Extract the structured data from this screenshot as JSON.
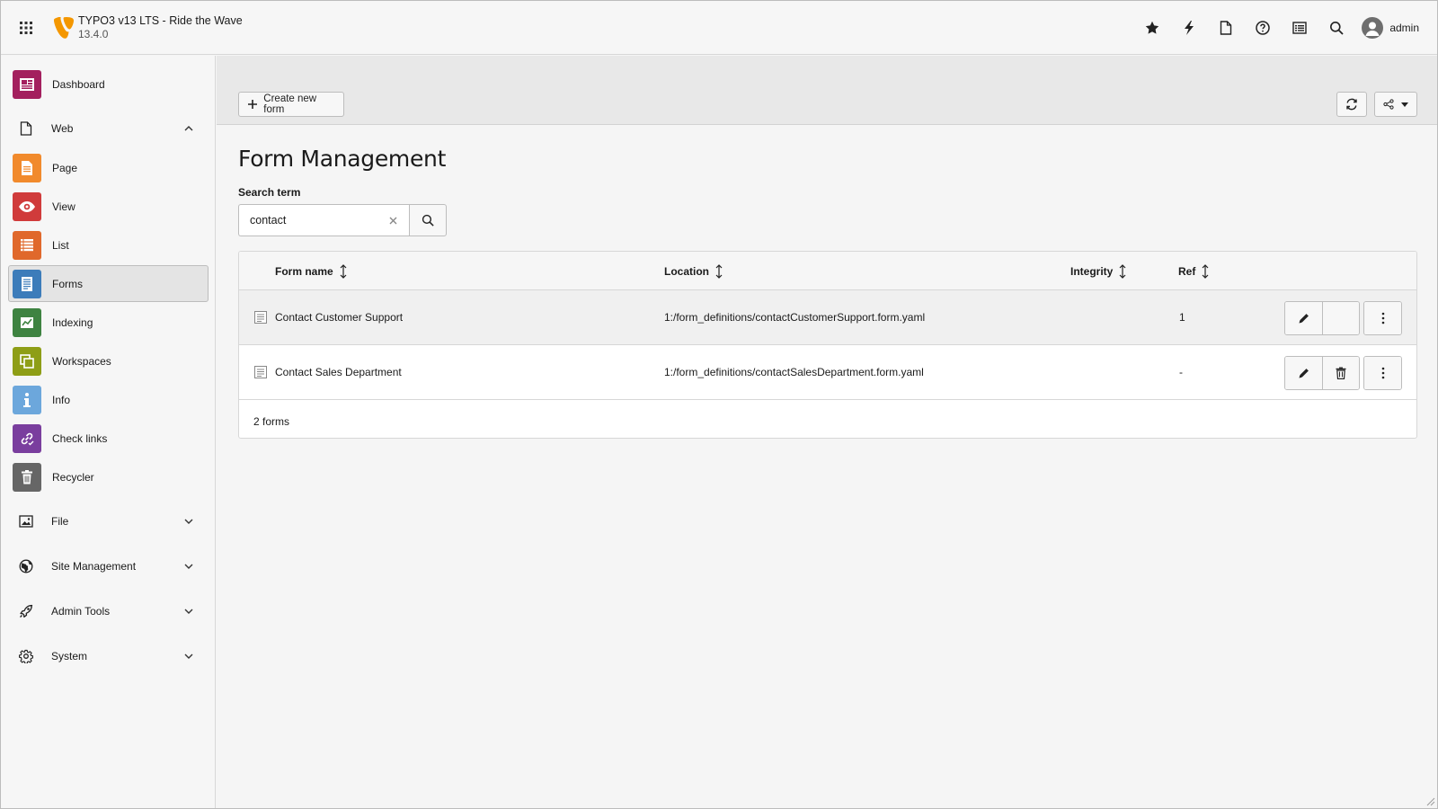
{
  "topbar": {
    "title": "TYPO3 v13 LTS - Ride the Wave",
    "version": "13.4.0",
    "user": "admin",
    "brand_color": "#f49700"
  },
  "sidebar": {
    "dashboard": "Dashboard",
    "web": "Web",
    "items": [
      {
        "label": "Page",
        "color": "#f18a2c"
      },
      {
        "label": "View",
        "color": "#d03b3b"
      },
      {
        "label": "List",
        "color": "#e0682b"
      },
      {
        "label": "Forms",
        "color": "#3c7cba"
      },
      {
        "label": "Indexing",
        "color": "#3e8341"
      },
      {
        "label": "Workspaces",
        "color": "#8e9e16"
      },
      {
        "label": "Info",
        "color": "#6ca7dc"
      },
      {
        "label": "Check links",
        "color": "#7a3e9e"
      },
      {
        "label": "Recycler",
        "color": "#666666"
      }
    ],
    "groups": {
      "file": "File",
      "site_management": "Site Management",
      "admin_tools": "Admin Tools",
      "system": "System"
    },
    "dashboard_color": "#a3205e"
  },
  "docheader": {
    "create_label": "Create new form"
  },
  "main": {
    "title": "Form Management",
    "search_label": "Search term",
    "search_value": "contact"
  },
  "table": {
    "headers": {
      "name": "Form name",
      "location": "Location",
      "integrity": "Integrity",
      "ref": "Ref"
    },
    "rows": [
      {
        "name": "Contact Customer Support",
        "location": "1:/form_definitions/contactCustomerSupport.form.yaml",
        "ref": "1"
      },
      {
        "name": "Contact Sales Department",
        "location": "1:/form_definitions/contactSalesDepartment.form.yaml",
        "ref": "-"
      }
    ],
    "footer": "2 forms"
  }
}
